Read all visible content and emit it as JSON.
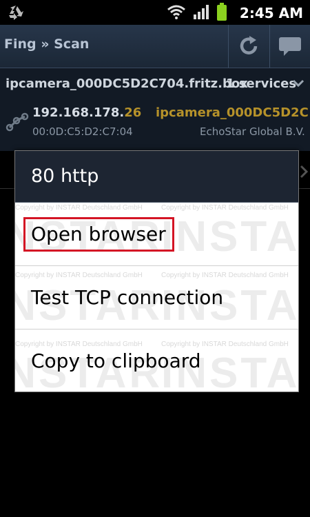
{
  "status_bar": {
    "time": "2:45 AM",
    "battery_color": "#8bd11f"
  },
  "app_bar": {
    "title": "Fing » Scan",
    "refresh_icon": "refresh-icon",
    "chat_icon": "chat-icon"
  },
  "host": {
    "hostname": "ipcamera_000DC5D2C704.fritz.box",
    "services": "1 services",
    "ip_prefix": "192.168.178.",
    "ip_last": "26",
    "mac": "00:0D:C5:D2:C7:04",
    "device_name": "ipcamera_000DC5D2C...",
    "vendor": "EchoStar Global B.V."
  },
  "dialog": {
    "title": "80 http",
    "items": [
      {
        "label": "Open browser"
      },
      {
        "label": "Test TCP connection"
      },
      {
        "label": "Copy to clipboard"
      }
    ],
    "highlight_color": "#d41424",
    "watermark": {
      "brand": "INSTAR",
      "copyright": "Copyright by INSTAR Deutschland GmbH"
    }
  }
}
